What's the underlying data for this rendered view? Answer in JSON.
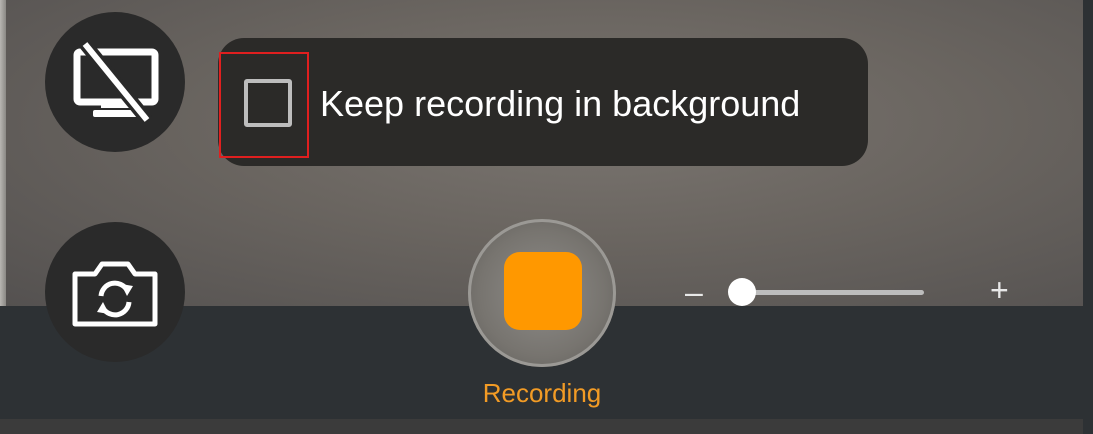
{
  "overlay": {
    "checkbox_label": "Keep recording in background",
    "checkbox_checked": false
  },
  "controls": {
    "screen_toggle_icon": "screen-off-icon",
    "switch_camera_icon": "camera-switch-icon",
    "record_icon": "stop-square-icon",
    "record_label": "Recording"
  },
  "zoom": {
    "minus_label": "–",
    "plus_label": "+",
    "level": 0
  },
  "colors": {
    "accent": "#ff9800",
    "highlight_box": "#e01f1f",
    "bar": "#2d3134"
  }
}
